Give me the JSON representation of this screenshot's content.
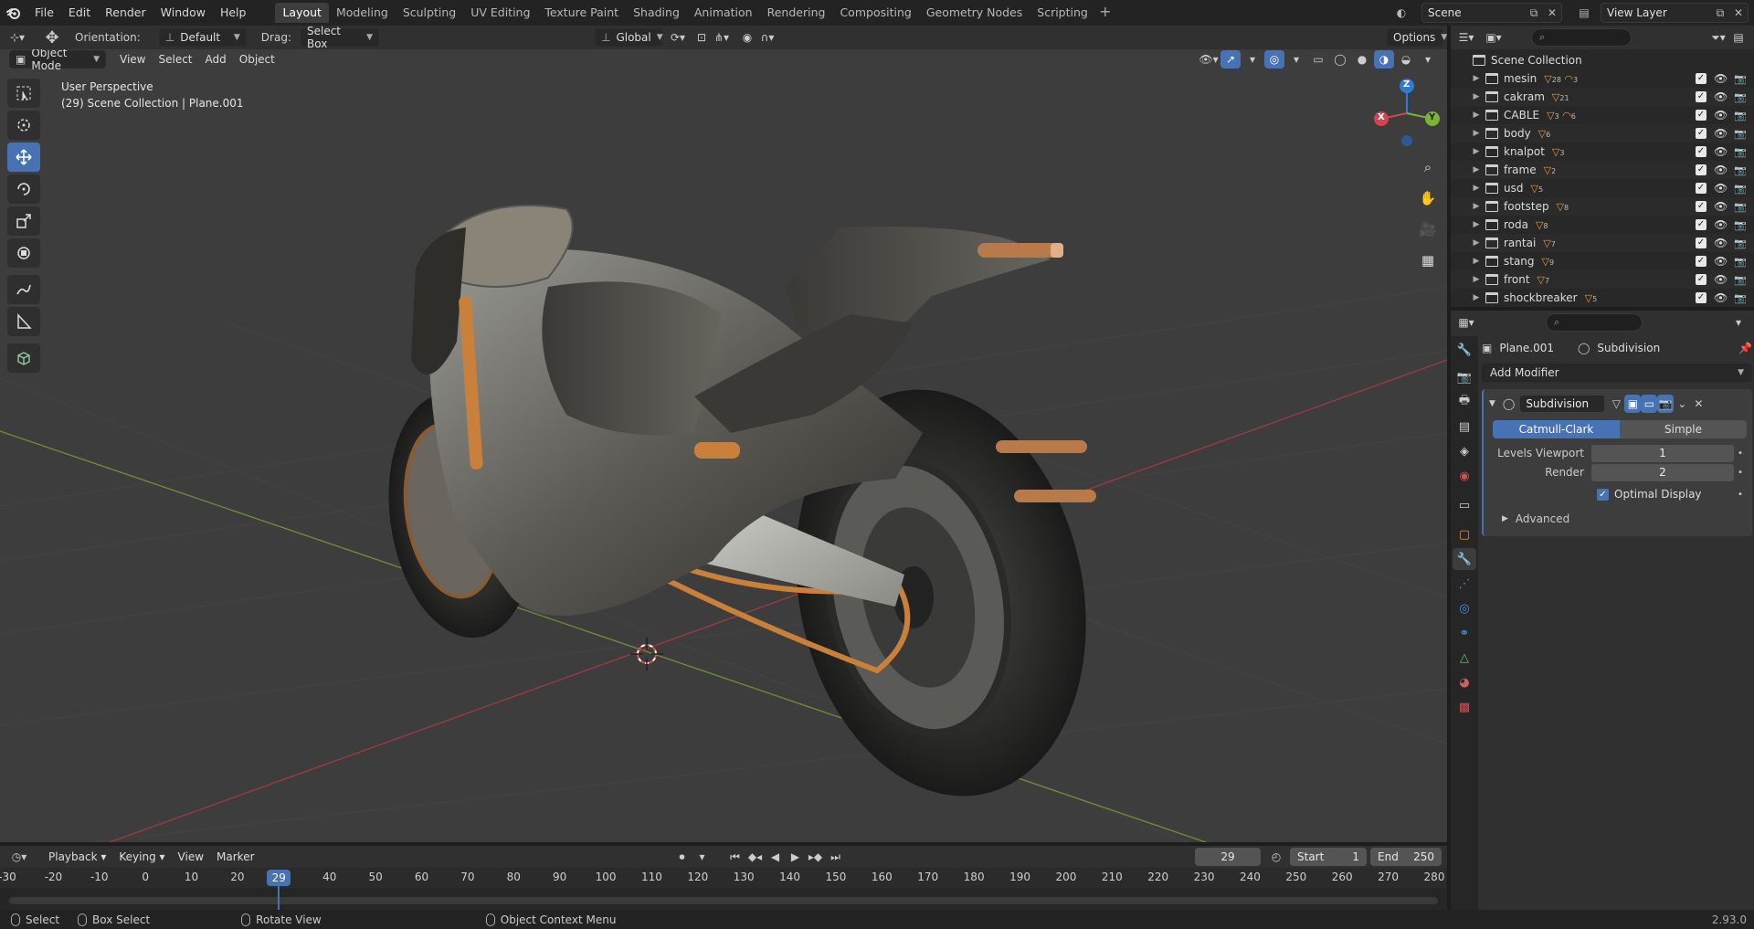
{
  "topbar": {
    "menus": [
      "File",
      "Edit",
      "Render",
      "Window",
      "Help"
    ],
    "workspace_tabs": [
      "Layout",
      "Modeling",
      "Sculpting",
      "UV Editing",
      "Texture Paint",
      "Shading",
      "Animation",
      "Rendering",
      "Compositing",
      "Geometry Nodes",
      "Scripting"
    ],
    "active_tab": "Layout",
    "scene": "Scene",
    "view_layer": "View Layer"
  },
  "viewport_header": {
    "orientation_label": "Orientation:",
    "orientation_value": "Default",
    "drag_label": "Drag:",
    "drag_value": "Select Box",
    "transform_orientation": "Global",
    "options_label": "Options",
    "mode": "Object Mode",
    "menus": [
      "View",
      "Select",
      "Add",
      "Object"
    ]
  },
  "viewport": {
    "perspective": "User Perspective",
    "context": "(29) Scene Collection | Plane.001",
    "gizmo": {
      "x": "X",
      "y": "Y",
      "z": "Z"
    }
  },
  "toolbar": {
    "tools": [
      "select-box-icon",
      "cursor-icon",
      "move-icon",
      "rotate-icon",
      "scale-icon",
      "transform-icon",
      "annotate-icon",
      "measure-icon",
      "add-cube-icon"
    ],
    "active": "move-icon"
  },
  "outliner": {
    "root": "Scene Collection",
    "rows": [
      {
        "name": "mesin",
        "badge": "28",
        "badge2": "3"
      },
      {
        "name": "cakram",
        "badge": "21",
        "badge2": ""
      },
      {
        "name": "CABLE",
        "badge": "3",
        "badge2": "6"
      },
      {
        "name": "body",
        "badge": "6",
        "badge2": ""
      },
      {
        "name": "knalpot",
        "badge": "3",
        "badge2": ""
      },
      {
        "name": "frame",
        "badge": "2",
        "badge2": ""
      },
      {
        "name": "usd",
        "badge": "5",
        "badge2": ""
      },
      {
        "name": "footstep",
        "badge": "8",
        "badge2": ""
      },
      {
        "name": "roda",
        "badge": "8",
        "badge2": ""
      },
      {
        "name": "rantai",
        "badge": "7",
        "badge2": ""
      },
      {
        "name": "stang",
        "badge": "9",
        "badge2": ""
      },
      {
        "name": "front",
        "badge": "7",
        "badge2": ""
      },
      {
        "name": "shockbreaker",
        "badge": "5",
        "badge2": ""
      }
    ]
  },
  "properties": {
    "object": "Plane.001",
    "modifier_crumb": "Subdivision",
    "add_modifier": "Add Modifier",
    "modifier": {
      "name": "Subdivision",
      "type_on": "Catmull-Clark",
      "type_off": "Simple",
      "levels_viewport_label": "Levels Viewport",
      "levels_viewport": "1",
      "render_label": "Render",
      "render": "2",
      "optimal_display": "Optimal Display",
      "advanced": "Advanced"
    }
  },
  "timeline": {
    "menus": [
      "Playback",
      "Keying",
      "View",
      "Marker"
    ],
    "current_frame": "29",
    "start_label": "Start",
    "start": "1",
    "end_label": "End",
    "end": "250",
    "ticks": [
      "-30",
      "-20",
      "-10",
      "0",
      "10",
      "20",
      "29",
      "40",
      "50",
      "60",
      "70",
      "80",
      "90",
      "100",
      "110",
      "120",
      "130",
      "140",
      "150",
      "160",
      "170",
      "180",
      "190",
      "200",
      "210",
      "220",
      "230",
      "240",
      "250",
      "260",
      "270",
      "280"
    ]
  },
  "statusbar": {
    "select": "Select",
    "box_select": "Box Select",
    "rotate_view": "Rotate View",
    "context_menu": "Object Context Menu",
    "version": "2.93.0"
  }
}
